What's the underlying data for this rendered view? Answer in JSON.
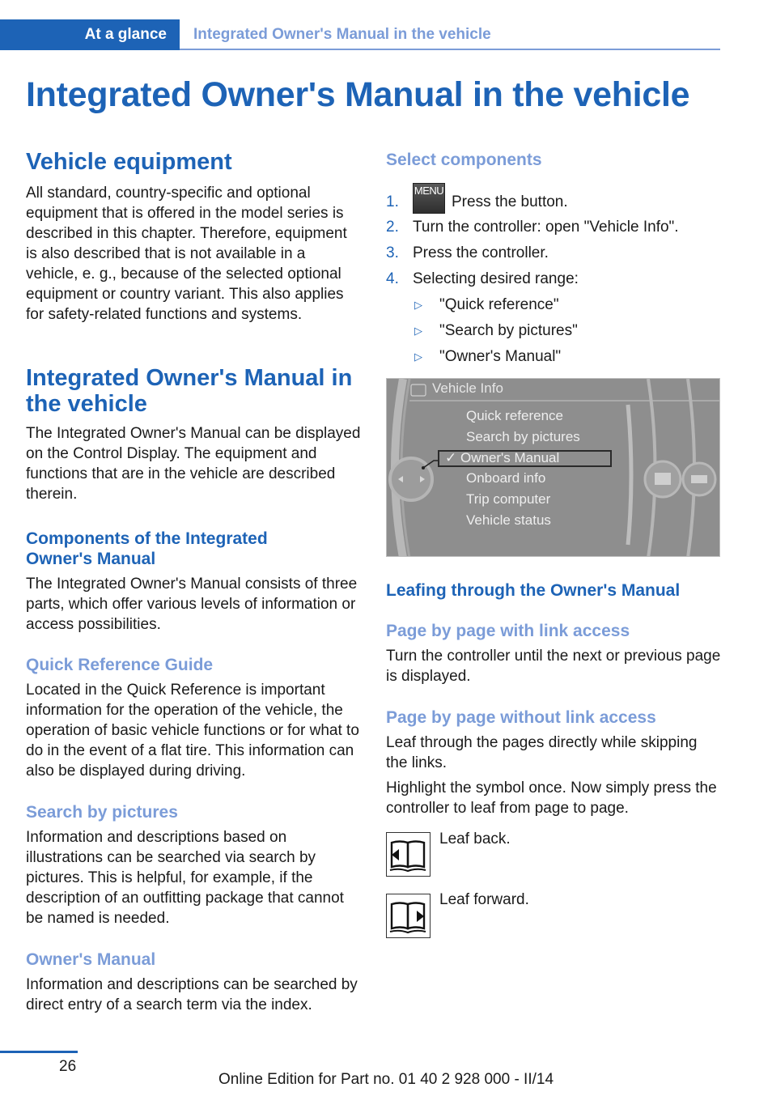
{
  "header": {
    "section_tab": "At a glance",
    "breadcrumb_title": "Integrated Owner's Manual in the vehicle",
    "accent_color": "#1d63b6",
    "secondary_color": "#7b9cd8"
  },
  "page_title": "Integrated Owner's Manual in the vehicle",
  "left_column": {
    "vehicle_equipment": {
      "heading": "Vehicle equipment",
      "text": "All standard, country-specific and optional equipment that is offered in the model series is described in this chapter. Therefore, equipment is also described that is not available in a vehicle, e. g., because of the selected optional equipment or country variant. This also applies for safety-related functions and systems."
    },
    "integrated_manual": {
      "heading": "Integrated Owner's Manual in the vehicle",
      "text": "The Integrated Owner's Manual can be displayed on the Control Display. The equipment and functions that are in the vehicle are described therein."
    },
    "components": {
      "heading": "Components of the Integrated Owner's Manual",
      "text": "The Integrated Owner's Manual consists of three parts, which offer various levels of information or access possibilities."
    },
    "quick_reference": {
      "heading": "Quick Reference Guide",
      "text": "Located in the Quick Reference is important information for the operation of the vehicle, the operation of basic vehicle functions or for what to do in the event of a flat tire. This information can also be displayed during driving."
    },
    "search_by_pictures": {
      "heading": "Search by pictures",
      "text": "Information and descriptions based on illustrations can be searched via search by pictures. This is helpful, for example, if the description of an outfitting package that cannot be named is needed."
    },
    "owners_manual": {
      "heading": "Owner's Manual",
      "text": "Information and descriptions can be searched by direct entry of a search term via the index."
    }
  },
  "right_column": {
    "select_components": {
      "heading": "Select components",
      "steps": [
        {
          "num": "1.",
          "button_label": "MENU",
          "text": "Press the button."
        },
        {
          "num": "2.",
          "text": "Turn the controller: open \"Vehicle Info\"."
        },
        {
          "num": "3.",
          "text": "Press the controller."
        },
        {
          "num": "4.",
          "text": "Selecting desired range:"
        }
      ],
      "sub_items": [
        "\"Quick reference\"",
        "\"Search by pictures\"",
        "\"Owner's Manual\""
      ]
    },
    "screen": {
      "title": "Vehicle Info",
      "items": [
        "Quick reference",
        "Search by pictures",
        "Owner's Manual",
        "Onboard info",
        "Trip computer",
        "Vehicle status"
      ],
      "selected_index": 2,
      "check_mark": "✓"
    },
    "leafing": {
      "heading": "Leafing through the Owner's Manual",
      "with_link": {
        "heading": "Page by page with link access",
        "text": "Turn the controller until the next or previous page is displayed."
      },
      "without_link": {
        "heading": "Page by page without link access",
        "text1": "Leaf through the pages directly while skipping the links.",
        "text2": "Highlight the symbol once. Now simply press the controller to leaf from page to page."
      },
      "icons": [
        {
          "icon": "book-leaf-back-icon",
          "label": "Leaf back."
        },
        {
          "icon": "book-leaf-forward-icon",
          "label": "Leaf forward."
        }
      ]
    }
  },
  "footer": {
    "page_number": "26",
    "edition": "Online Edition for Part no. 01 40 2 928 000 - II/14"
  }
}
